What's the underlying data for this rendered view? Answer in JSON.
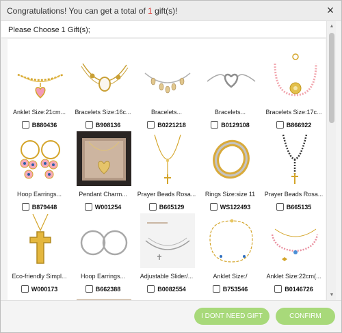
{
  "modal": {
    "title_prefix": "Congratulations! You can get a total of ",
    "title_count": "1",
    "title_suffix": " gift(s)!",
    "close_label": "×",
    "instruction": "Please Choose 1 Gift(s);"
  },
  "products": [
    {
      "name": "Anklet Size:21cm...",
      "sku": "B880436",
      "icon": "gold-chain-anklet-pink-heart"
    },
    {
      "name": "Bracelets Size:16c...",
      "sku": "B908136",
      "icon": "gold-bracelet-shell"
    },
    {
      "name": "Bracelets...",
      "sku": "B0221218",
      "icon": "silver-charm-bracelet"
    },
    {
      "name": "Bracelets...",
      "sku": "B0129108",
      "icon": "silver-heart-bracelet"
    },
    {
      "name": "Bracelets Size:17c...",
      "sku": "B866922",
      "icon": "pink-bead-bracelet"
    },
    {
      "name": "Hoop Earrings...",
      "sku": "B879448",
      "icon": "pink-eye-earrings"
    },
    {
      "name": "Pendant Charm...",
      "sku": "W001254",
      "icon": "heart-pendant-box"
    },
    {
      "name": "Prayer Beads Rosa...",
      "sku": "B665129",
      "icon": "gold-rosary"
    },
    {
      "name": "Rings Size:size 11",
      "sku": "WS122493",
      "icon": "gold-silver-ring"
    },
    {
      "name": "Prayer Beads Rosa...",
      "sku": "B665135",
      "icon": "black-bead-rosary"
    },
    {
      "name": "Eco-friendly Simpl...",
      "sku": "W000173",
      "icon": "gold-cross-pendant"
    },
    {
      "name": "Hoop Earrings...",
      "sku": "B662388",
      "icon": "silver-hoop-earrings"
    },
    {
      "name": "Adjustable Slider/...",
      "sku": "B0082554",
      "icon": "silver-slider-bracelet"
    },
    {
      "name": "Anklet Size:/",
      "sku": "B753546",
      "icon": "gold-bead-anklet"
    },
    {
      "name": "Anklet Size:22cm(...",
      "sku": "B0146726",
      "icon": "rose-bead-anklet"
    }
  ],
  "footer": {
    "no_gift_label": "I DONT NEED GIFT",
    "confirm_label": "CONFIRM"
  },
  "colors": {
    "accent_button": "#a8d97a",
    "highlight_count": "#d9322d"
  }
}
